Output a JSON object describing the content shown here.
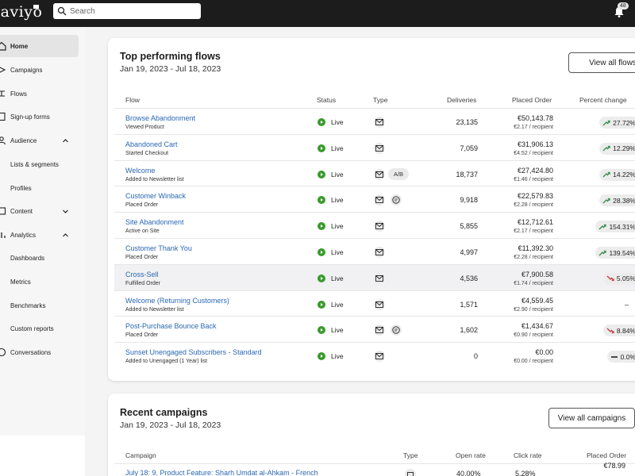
{
  "app": {
    "logo": "laviyo"
  },
  "search": {
    "placeholder": "Search"
  },
  "notifications": {
    "count": "48"
  },
  "sidebar": {
    "items": [
      {
        "label": "Home",
        "icon": "home-icon",
        "active": true
      },
      {
        "label": "Campaigns",
        "icon": "campaign-icon"
      },
      {
        "label": "Flows",
        "icon": "flows-icon"
      },
      {
        "label": "Sign-up forms",
        "icon": "form-icon"
      },
      {
        "label": "Audience",
        "icon": "audience-icon",
        "expand": "up"
      },
      {
        "label": "Lists & segments"
      },
      {
        "label": "Profiles"
      },
      {
        "label": "Content",
        "icon": "content-icon",
        "expand": "down"
      },
      {
        "label": "Analytics",
        "icon": "analytics-icon",
        "expand": "up"
      },
      {
        "label": "Dashboards"
      },
      {
        "label": "Metrics"
      },
      {
        "label": "Benchmarks"
      },
      {
        "label": "Custom reports"
      },
      {
        "label": "Conversations",
        "icon": "conversations-icon"
      }
    ]
  },
  "flows_card": {
    "title": "Top performing flows",
    "date_range": "Jan 19, 2023 - Jul 18, 2023",
    "view_all_label": "View all flows",
    "columns": [
      "Flow",
      "Status",
      "Type",
      "Deliveries",
      "Placed Order",
      "Percent change"
    ],
    "rows": [
      {
        "name": "Browse Abandonment",
        "trigger": "Viewed Product",
        "status": "Live",
        "types": [
          "email"
        ],
        "deliveries": "23,135",
        "placed": "€50,143.78",
        "per_recipient": "€2.17 / recipient",
        "change": "27.72%",
        "trend": "up"
      },
      {
        "name": "Abandoned Cart",
        "trigger": "Started Checkout",
        "status": "Live",
        "types": [
          "email"
        ],
        "deliveries": "7,059",
        "placed": "€31,906.13",
        "per_recipient": "€4.52 / recipient",
        "change": "12.29%",
        "trend": "up"
      },
      {
        "name": "Welcome",
        "trigger": "Added to Newsletter list",
        "status": "Live",
        "types": [
          "email",
          "ab"
        ],
        "deliveries": "18,737",
        "placed": "€27,424.80",
        "per_recipient": "€1.46 / recipient",
        "change": "14.22%",
        "trend": "up"
      },
      {
        "name": "Customer Winback",
        "trigger": "Placed Order",
        "status": "Live",
        "types": [
          "email",
          "sms"
        ],
        "deliveries": "9,918",
        "placed": "€22,579.83",
        "per_recipient": "€2.28 / recipient",
        "change": "28.38%",
        "trend": "up"
      },
      {
        "name": "Site Abandonment",
        "trigger": "Active on Site",
        "status": "Live",
        "types": [
          "email"
        ],
        "deliveries": "5,855",
        "placed": "€12,712.61",
        "per_recipient": "€2.17 / recipient",
        "change": "154.31%",
        "trend": "up"
      },
      {
        "name": "Customer Thank You",
        "trigger": "Placed Order",
        "status": "Live",
        "types": [
          "email"
        ],
        "deliveries": "4,997",
        "placed": "€11,392.30",
        "per_recipient": "€2.28 / recipient",
        "change": "139.54%",
        "trend": "up"
      },
      {
        "name": "Cross-Sell",
        "trigger": "Fulfilled Order",
        "status": "Live",
        "types": [
          "email"
        ],
        "deliveries": "4,536",
        "placed": "€7,900.58",
        "per_recipient": "€1.74 / recipient",
        "change": "5.05%",
        "trend": "down"
      },
      {
        "name": "Welcome (Returning Customers)",
        "trigger": "Added to Newsletter list",
        "status": "Live",
        "types": [
          "email"
        ],
        "deliveries": "1,571",
        "placed": "€4,559.45",
        "per_recipient": "€2.90 / recipient",
        "change": "–",
        "trend": "none"
      },
      {
        "name": "Post-Purchase Bounce Back",
        "trigger": "Placed Order",
        "status": "Live",
        "types": [
          "email",
          "sms"
        ],
        "deliveries": "1,602",
        "placed": "€1,434.67",
        "per_recipient": "€0.90 / recipient",
        "change": "8.84%",
        "trend": "down"
      },
      {
        "name": "Sunset Unengaged Subscribers - Standard",
        "trigger": "Added to Unengaged (1 Year) list",
        "status": "Live",
        "types": [
          "email"
        ],
        "deliveries": "0",
        "placed": "€0.00",
        "per_recipient": "€0.00 / recipient",
        "change": "0.0%",
        "trend": "flat"
      }
    ]
  },
  "campaigns_card": {
    "title": "Recent campaigns",
    "date_range": "Jan 19, 2023 - Jul 18, 2023",
    "view_all_label": "View all campaigns",
    "columns": [
      "Campaign",
      "Type",
      "Open rate",
      "Click rate",
      "Placed Order"
    ],
    "rows": [
      {
        "name": "July 18: 9. Product Feature: Sharh Umdat al-Ahkam - French",
        "type": "email",
        "open_rate": "40.00%",
        "click_rate": "5.28%",
        "placed": "€78.99"
      }
    ]
  },
  "colors": {
    "topbar": "#1c1c1c",
    "link": "#2a67b3",
    "live_green": "#3a9a2c",
    "trend_up": "#2f8a4a",
    "trend_down": "#c43a36"
  }
}
